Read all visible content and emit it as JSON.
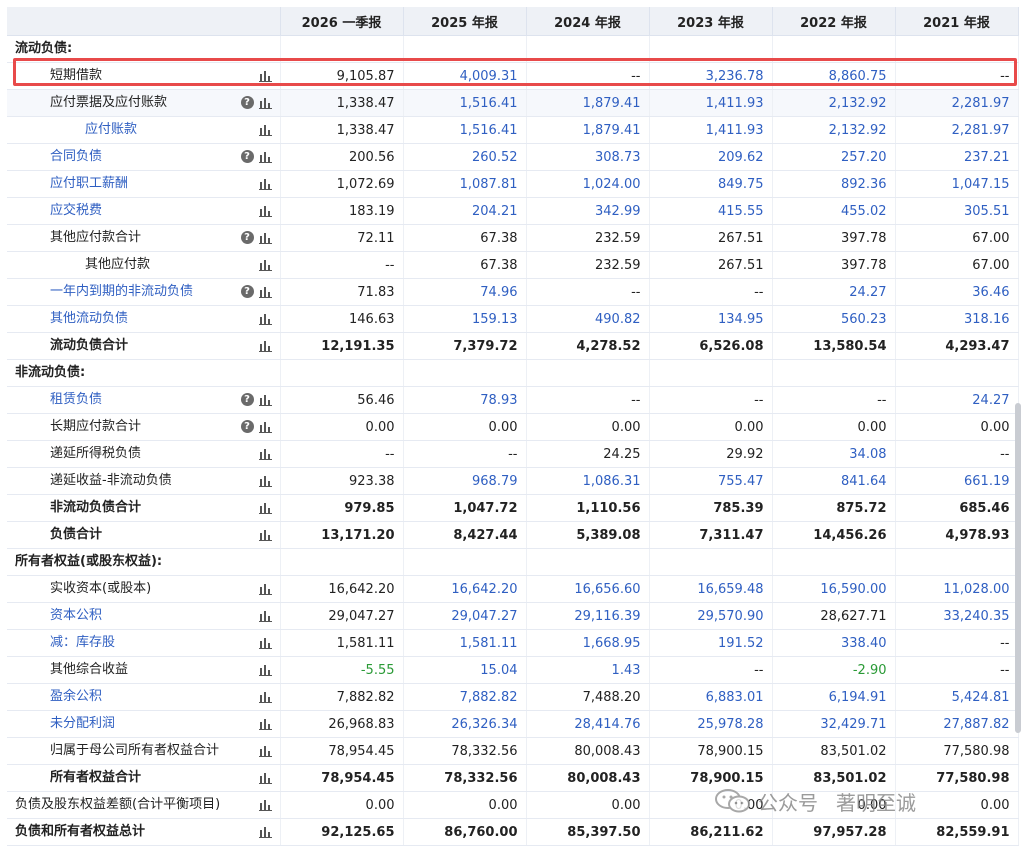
{
  "headers": [
    "",
    "2026 一季报",
    "2025 年报",
    "2024 年报",
    "2023 年报",
    "2022 年报",
    "2021 年报"
  ],
  "rows": [
    {
      "label": "流动负债:",
      "type": "section",
      "values": [],
      "link": []
    },
    {
      "label": "短期借款",
      "type": "item",
      "indent": 1,
      "icon": "bar",
      "values": [
        "9,105.87",
        "4,009.31",
        "--",
        "3,236.78",
        "8,860.75",
        "--"
      ],
      "link": [
        false,
        true,
        false,
        true,
        true,
        false
      ]
    },
    {
      "label": "应付票据及应付账款",
      "type": "item",
      "indent": 1,
      "icon": "both",
      "values": [
        "1,338.47",
        "1,516.41",
        "1,879.41",
        "1,411.93",
        "2,132.92",
        "2,281.97"
      ],
      "link": [
        false,
        true,
        true,
        true,
        true,
        true
      ],
      "sub": true
    },
    {
      "label": "应付账款",
      "type": "item",
      "indent": 2,
      "icon": "bar",
      "values": [
        "1,338.47",
        "1,516.41",
        "1,879.41",
        "1,411.93",
        "2,132.92",
        "2,281.97"
      ],
      "link": [
        false,
        true,
        true,
        true,
        true,
        true
      ],
      "lbllink": true
    },
    {
      "label": "合同负债",
      "type": "item",
      "indent": 1,
      "icon": "both",
      "values": [
        "200.56",
        "260.52",
        "308.73",
        "209.62",
        "257.20",
        "237.21"
      ],
      "link": [
        false,
        true,
        true,
        true,
        true,
        true
      ],
      "lbllink": true
    },
    {
      "label": "应付职工薪酬",
      "type": "item",
      "indent": 1,
      "icon": "bar",
      "values": [
        "1,072.69",
        "1,087.81",
        "1,024.00",
        "849.75",
        "892.36",
        "1,047.15"
      ],
      "link": [
        false,
        true,
        true,
        true,
        true,
        true
      ],
      "lbllink": true
    },
    {
      "label": "应交税费",
      "type": "item",
      "indent": 1,
      "icon": "bar",
      "values": [
        "183.19",
        "204.21",
        "342.99",
        "415.55",
        "455.02",
        "305.51"
      ],
      "link": [
        false,
        true,
        true,
        true,
        true,
        true
      ],
      "lbllink": true
    },
    {
      "label": "其他应付款合计",
      "type": "item",
      "indent": 1,
      "icon": "both",
      "values": [
        "72.11",
        "67.38",
        "232.59",
        "267.51",
        "397.78",
        "67.00"
      ],
      "link": [
        false,
        false,
        false,
        false,
        false,
        false
      ]
    },
    {
      "label": "其他应付款",
      "type": "item",
      "indent": 2,
      "icon": "bar",
      "values": [
        "--",
        "67.38",
        "232.59",
        "267.51",
        "397.78",
        "67.00"
      ],
      "link": [
        false,
        false,
        false,
        false,
        false,
        false
      ]
    },
    {
      "label": "一年内到期的非流动负债",
      "type": "item",
      "indent": 1,
      "icon": "both",
      "values": [
        "71.83",
        "74.96",
        "--",
        "--",
        "24.27",
        "36.46"
      ],
      "link": [
        false,
        true,
        false,
        false,
        true,
        true
      ],
      "lbllink": true
    },
    {
      "label": "其他流动负债",
      "type": "item",
      "indent": 1,
      "icon": "bar",
      "values": [
        "146.63",
        "159.13",
        "490.82",
        "134.95",
        "560.23",
        "318.16"
      ],
      "link": [
        false,
        true,
        true,
        true,
        true,
        true
      ],
      "lbllink": true
    },
    {
      "label": "流动负债合计",
      "type": "item",
      "indent": 1,
      "icon": "bar",
      "bold": true,
      "values": [
        "12,191.35",
        "7,379.72",
        "4,278.52",
        "6,526.08",
        "13,580.54",
        "4,293.47"
      ],
      "link": [
        false,
        false,
        false,
        false,
        false,
        false
      ]
    },
    {
      "label": "非流动负债:",
      "type": "section",
      "values": [],
      "link": []
    },
    {
      "label": "租赁负债",
      "type": "item",
      "indent": 1,
      "icon": "both",
      "values": [
        "56.46",
        "78.93",
        "--",
        "--",
        "--",
        "24.27"
      ],
      "link": [
        false,
        true,
        false,
        false,
        false,
        true
      ],
      "lbllink": true
    },
    {
      "label": "长期应付款合计",
      "type": "item",
      "indent": 1,
      "icon": "both",
      "values": [
        "0.00",
        "0.00",
        "0.00",
        "0.00",
        "0.00",
        "0.00"
      ],
      "link": [
        false,
        false,
        false,
        false,
        false,
        false
      ]
    },
    {
      "label": "递延所得税负债",
      "type": "item",
      "indent": 1,
      "icon": "bar",
      "values": [
        "--",
        "--",
        "24.25",
        "29.92",
        "34.08",
        "--"
      ],
      "link": [
        false,
        false,
        false,
        false,
        true,
        false
      ]
    },
    {
      "label": "递延收益-非流动负债",
      "type": "item",
      "indent": 1,
      "icon": "bar",
      "values": [
        "923.38",
        "968.79",
        "1,086.31",
        "755.47",
        "841.64",
        "661.19"
      ],
      "link": [
        false,
        true,
        true,
        true,
        true,
        true
      ]
    },
    {
      "label": "非流动负债合计",
      "type": "item",
      "indent": 1,
      "icon": "bar",
      "bold": true,
      "values": [
        "979.85",
        "1,047.72",
        "1,110.56",
        "785.39",
        "875.72",
        "685.46"
      ],
      "link": [
        false,
        false,
        false,
        false,
        false,
        false
      ]
    },
    {
      "label": "负债合计",
      "type": "item",
      "indent": 1,
      "icon": "bar",
      "bold": true,
      "values": [
        "13,171.20",
        "8,427.44",
        "5,389.08",
        "7,311.47",
        "14,456.26",
        "4,978.93"
      ],
      "link": [
        false,
        false,
        false,
        false,
        false,
        false
      ]
    },
    {
      "label": "所有者权益(或股东权益):",
      "type": "section",
      "values": [],
      "link": []
    },
    {
      "label": "实收资本(或股本)",
      "type": "item",
      "indent": 1,
      "icon": "bar",
      "values": [
        "16,642.20",
        "16,642.20",
        "16,656.60",
        "16,659.48",
        "16,590.00",
        "11,028.00"
      ],
      "link": [
        false,
        true,
        true,
        true,
        true,
        true
      ]
    },
    {
      "label": "资本公积",
      "type": "item",
      "indent": 1,
      "icon": "bar",
      "values": [
        "29,047.27",
        "29,047.27",
        "29,116.39",
        "29,570.90",
        "28,627.71",
        "33,240.35"
      ],
      "link": [
        false,
        true,
        true,
        true,
        false,
        true
      ],
      "lbllink": true
    },
    {
      "label": "减：库存股",
      "type": "item",
      "indent": 1,
      "icon": "bar",
      "values": [
        "1,581.11",
        "1,581.11",
        "1,668.95",
        "191.52",
        "338.40",
        "--"
      ],
      "link": [
        false,
        true,
        true,
        true,
        true,
        false
      ],
      "lbllink": true
    },
    {
      "label": "其他综合收益",
      "type": "item",
      "indent": 1,
      "icon": "bar",
      "values": [
        "-5.55",
        "15.04",
        "1.43",
        "--",
        "-2.90",
        "--"
      ],
      "link": [
        false,
        true,
        true,
        false,
        false,
        false
      ],
      "green": [
        true,
        false,
        false,
        false,
        true,
        false
      ]
    },
    {
      "label": "盈余公积",
      "type": "item",
      "indent": 1,
      "icon": "bar",
      "values": [
        "7,882.82",
        "7,882.82",
        "7,488.20",
        "6,883.01",
        "6,194.91",
        "5,424.81"
      ],
      "link": [
        false,
        true,
        false,
        true,
        true,
        true
      ],
      "lbllink": true
    },
    {
      "label": "未分配利润",
      "type": "item",
      "indent": 1,
      "icon": "bar",
      "values": [
        "26,968.83",
        "26,326.34",
        "28,414.76",
        "25,978.28",
        "32,429.71",
        "27,887.82"
      ],
      "link": [
        false,
        true,
        true,
        true,
        true,
        true
      ],
      "lbllink": true
    },
    {
      "label": "归属于母公司所有者权益合计",
      "type": "item",
      "indent": 1,
      "icon": "bar",
      "values": [
        "78,954.45",
        "78,332.56",
        "80,008.43",
        "78,900.15",
        "83,501.02",
        "77,580.98"
      ],
      "link": [
        false,
        false,
        false,
        false,
        false,
        false
      ]
    },
    {
      "label": "所有者权益合计",
      "type": "item",
      "indent": 1,
      "icon": "bar",
      "bold": true,
      "values": [
        "78,954.45",
        "78,332.56",
        "80,008.43",
        "78,900.15",
        "83,501.02",
        "77,580.98"
      ],
      "link": [
        false,
        false,
        false,
        false,
        false,
        false
      ]
    },
    {
      "label": "负债及股东权益差额(合计平衡项目)",
      "type": "item",
      "indent": 0,
      "icon": "bar",
      "values": [
        "0.00",
        "0.00",
        "0.00",
        "0.00",
        "0.00",
        "0.00"
      ],
      "link": [
        false,
        false,
        false,
        false,
        false,
        false
      ]
    },
    {
      "label": "负债和所有者权益总计",
      "type": "item",
      "indent": 0,
      "icon": "bar",
      "bold": true,
      "values": [
        "92,125.65",
        "86,760.00",
        "85,397.50",
        "86,211.62",
        "97,957.28",
        "82,559.91"
      ],
      "link": [
        false,
        false,
        false,
        false,
        false,
        false
      ]
    }
  ],
  "help_icon_glyph": "?",
  "watermark": {
    "text1": "公众号",
    "text2": "著明至诚",
    "icon": "wechat-icon"
  },
  "colors": {
    "link": "#2f5fc2",
    "highlight": "#e84a4a",
    "negative": "#2a9a36"
  }
}
